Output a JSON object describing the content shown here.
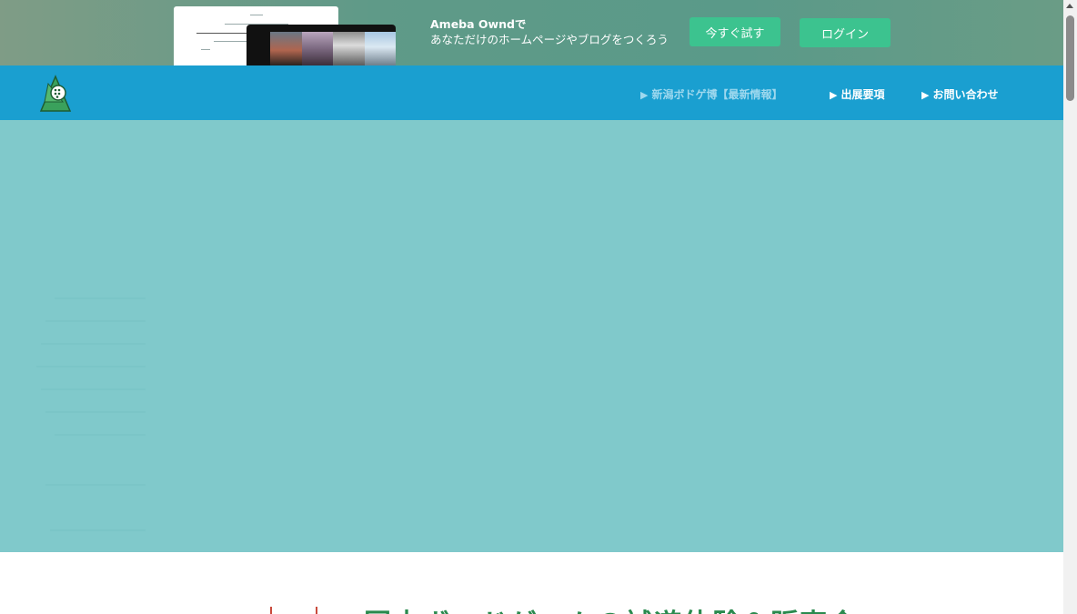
{
  "banner": {
    "brand_line": "Ameba Owndで",
    "tagline": "あなただけのホームページやブログをつくろう",
    "try_button": "今すぐ試す",
    "login_button": "ログイン"
  },
  "header": {
    "nav": [
      {
        "label": "新潟ボドゲ博【最新情報】",
        "active": true
      },
      {
        "label": "出展要項",
        "active": false
      },
      {
        "label": "お問い合わせ",
        "active": false
      }
    ]
  },
  "hero": {
    "color": "#80c9cb"
  },
  "section": {
    "heading": "国内ボードゲームの試遊体験＆販売会"
  },
  "colors": {
    "banner_button": "#3cc38f",
    "header": "#1a9fd0",
    "hero": "#80c9cb",
    "heading": "#2a8a4e"
  },
  "icons": {
    "nav_arrow": "▶",
    "logo": "logo-triangle-dice-icon"
  }
}
